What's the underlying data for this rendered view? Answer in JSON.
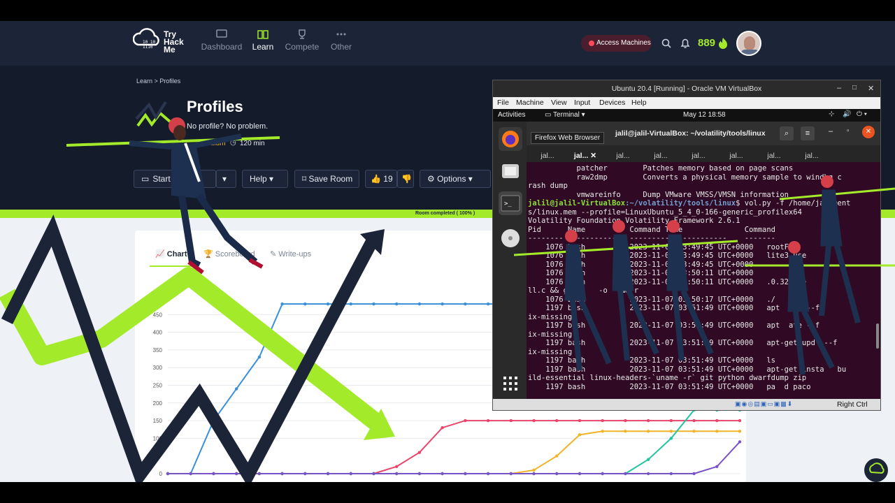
{
  "nav": {
    "logo_text": "Try Hack Me",
    "items": [
      {
        "label": "Dashboard",
        "icon": "monitor-icon"
      },
      {
        "label": "Learn",
        "icon": "book-icon"
      },
      {
        "label": "Compete",
        "icon": "trophy-icon"
      },
      {
        "label": "Other",
        "icon": "dots-icon"
      }
    ],
    "access_label": "Access Machines",
    "points": "889"
  },
  "hero": {
    "breadcrumb": "Learn > Profiles",
    "title": "Profiles",
    "subtitle": "No profile? No problem.",
    "difficulty": "Medium",
    "duration": "120 min"
  },
  "toolbar": {
    "start_label": "Start Atta",
    "help_label": "Help",
    "save_label": "Save Room",
    "likes": "19",
    "options_label": "Options"
  },
  "progress": {
    "label": "Room completed ( 100% )",
    "value": 1.0
  },
  "tabs": [
    {
      "label": "Chart"
    },
    {
      "label": "Scoreboard"
    },
    {
      "label": "Write-ups"
    }
  ],
  "chart_data": {
    "type": "line",
    "yticks": [
      "450",
      "400",
      "350",
      "300",
      "250",
      "200",
      "150",
      "100",
      "0"
    ],
    "ylim": [
      0,
      500
    ],
    "series": [
      {
        "color": "#3a8fd9",
        "values": [
          0,
          0,
          150,
          240,
          330,
          480,
          480,
          480,
          480,
          480,
          480,
          480,
          480,
          480,
          480,
          480,
          480,
          480,
          480,
          480,
          480,
          480,
          480,
          480,
          480,
          480
        ]
      },
      {
        "color": "#e8456a",
        "values": [
          0,
          0,
          0,
          0,
          0,
          0,
          0,
          0,
          0,
          0,
          20,
          60,
          130,
          150,
          150,
          150,
          150,
          150,
          150,
          150,
          150,
          150,
          150,
          150,
          150,
          150
        ]
      },
      {
        "color": "#f0b429",
        "values": [
          0,
          0,
          0,
          0,
          0,
          0,
          0,
          0,
          0,
          0,
          0,
          0,
          0,
          0,
          0,
          0,
          10,
          50,
          110,
          120,
          120,
          120,
          120,
          120,
          120,
          120
        ]
      },
      {
        "color": "#22c4a0",
        "values": [
          0,
          0,
          0,
          0,
          0,
          0,
          0,
          0,
          0,
          0,
          0,
          0,
          0,
          0,
          0,
          0,
          0,
          0,
          0,
          0,
          0,
          40,
          100,
          180,
          180,
          180
        ]
      },
      {
        "color": "#7a52c7",
        "values": [
          0,
          0,
          0,
          0,
          0,
          0,
          0,
          0,
          0,
          0,
          0,
          0,
          0,
          0,
          0,
          0,
          0,
          0,
          0,
          0,
          0,
          0,
          0,
          0,
          20,
          90
        ]
      }
    ]
  },
  "vm": {
    "window_title": "Ubuntu 20.4 [Running] - Oracle VM VirtualBox",
    "menu": [
      "File",
      "Machine",
      "View",
      "Input",
      "Devices",
      "Help"
    ],
    "activities": "Activities",
    "app": "Terminal",
    "clock": "May 12  18:58",
    "term_title": "jalil@jalil-VirtualBox: ~/volatility/tools/linux",
    "tooltip": "Firefox Web Browser",
    "tabs": [
      "jal...",
      "jal...",
      "jal...",
      "jal...",
      "jal...",
      "jal...",
      "jal...",
      "jal..."
    ],
    "lines": [
      "           patcher        Patches memory based on page scans",
      "           raw2dmp        Converts a physical memory sample to windbg c",
      "rash dump",
      "           vmwareinfo     Dump VMware VMSS/VMSN information",
      "jalil@jalil-VirtualBox:~/volatility/tools/linux$ vol.py -f /home/ja  ment",
      "s/linux.mem --profile=LinuxUbuntu_5_4_0-166-generic_profilex64",
      "Volatility Foundation Volatility Framework 2.6.1",
      "Pid      Name          Command Time              Command",
      "-------- ------------- ----------------------    -------",
      "    1076 bash          2023-11-07 03:49:45 UTC+0000   rootFtr",
      "    1076 bash          2023-11-07 03:49:45 UTC+0000   lite3 use",
      "    1076 bash          2023-11-07 03:49:45 UTC+0000",
      "    1076 bash          2023-11-07 03:50:11 UTC+0000",
      "    1076 bash          2023-11-07 03:50:11 UTC+0000   .0.32/she",
      "ll.c && gcc     -o   && r",
      "    1076 bash          2023-11-07 03:50:17 UTC+0000   ./",
      "    1197 bash          2023-11-07 03:51:49 UTC+0000   apt  ode --f",
      "ix-missing",
      "    1197 bash          2023-11-07 03:51:49 UTC+0000   apt  ate --f",
      "ix-missing",
      "    1197 bash          2023-11-07 03:51:49 UTC+0000   apt-get upd  --f",
      "ix-missing",
      "    1197 bash          2023-11-07 03:51:49 UTC+0000   ls",
      "    1197 bash          2023-11-07 03:51:49 UTC+0000   apt-get insta   bu",
      "ild-essential linux-headers-`uname -r` git python dwarfdump zip",
      "    1197 bash          2023-11-07 03:51:49 UTC+0000   pa  d paco"
    ],
    "host_key": "Right Ctrl"
  }
}
